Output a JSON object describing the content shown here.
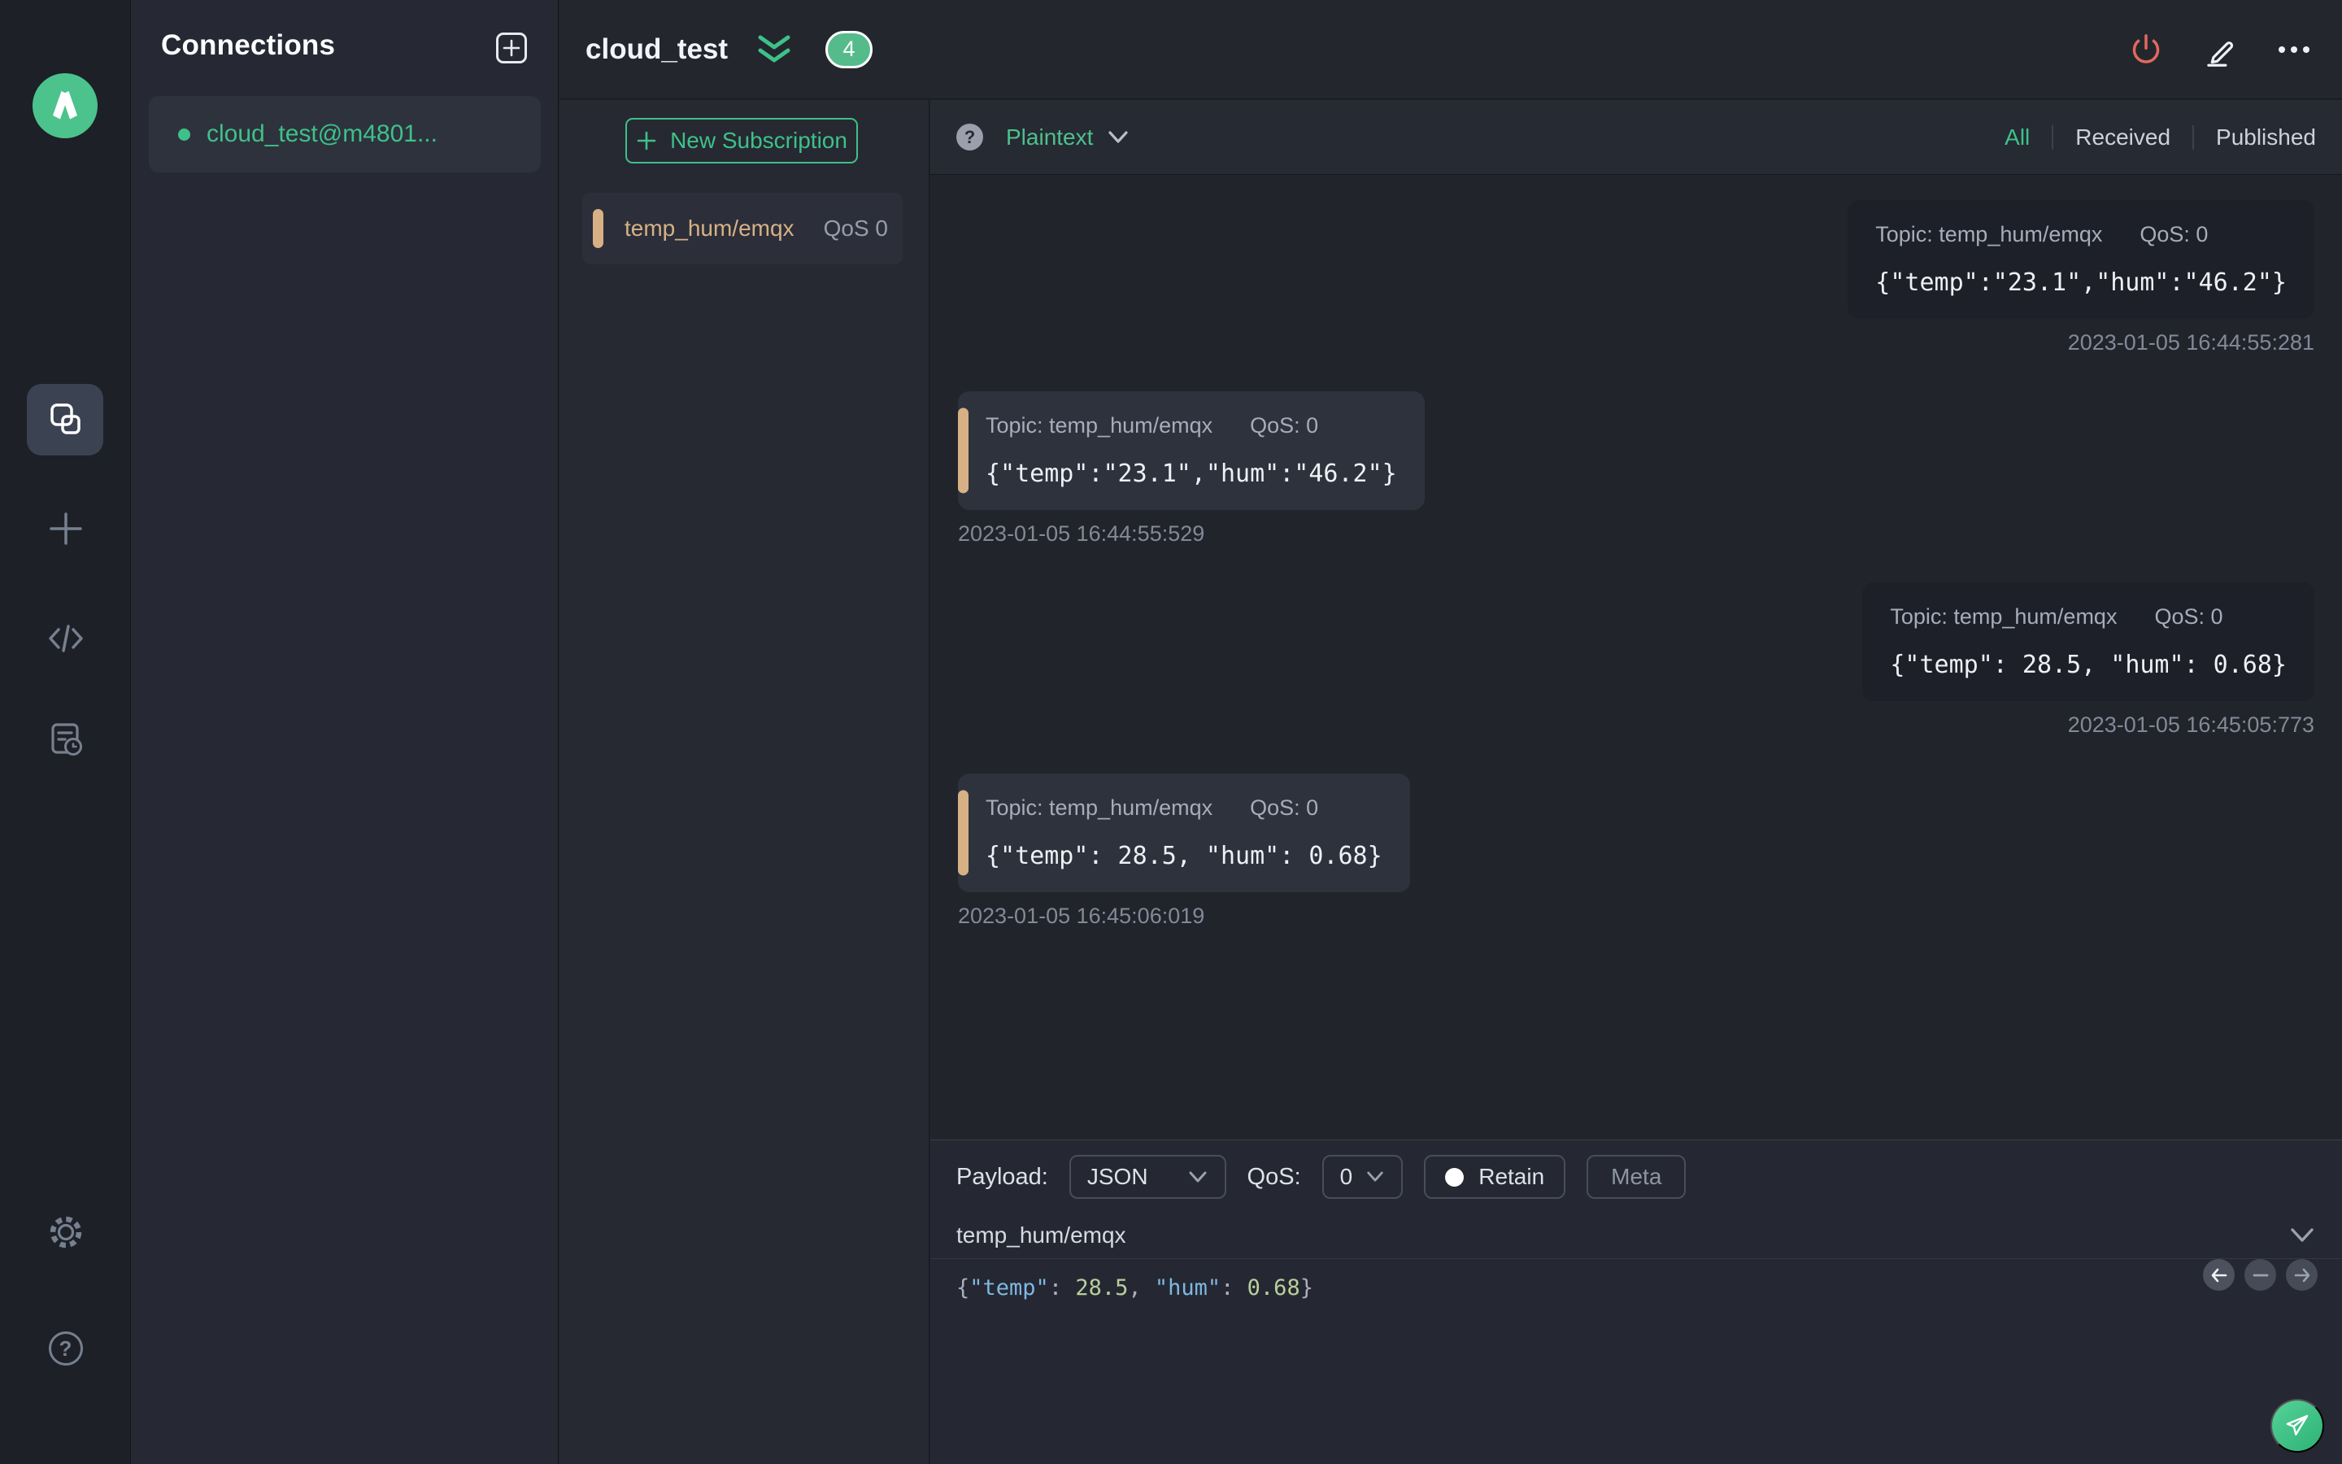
{
  "app": {
    "accent_green": "#3ec189",
    "topic_tan": "#d7b185",
    "danger_red": "#e0695e",
    "syntax": {
      "key": "#7fb8e3",
      "number": "#b8cf9c",
      "punctuation": "#a9b1bd"
    }
  },
  "rail": {
    "help_glyph": "?"
  },
  "connections": {
    "title": "Connections",
    "items": [
      {
        "label": "cloud_test@m4801...",
        "status": "connected"
      }
    ]
  },
  "header": {
    "title": "cloud_test",
    "subscription_count": "4"
  },
  "subscriptions": {
    "new_button_label": "New Subscription",
    "items": [
      {
        "topic": "temp_hum/emqx",
        "qos": "QoS 0"
      }
    ]
  },
  "message_toolbar": {
    "help_glyph": "?",
    "format": "Plaintext",
    "tabs": [
      {
        "label": "All",
        "active": true
      },
      {
        "label": "Received",
        "active": false
      },
      {
        "label": "Published",
        "active": false
      }
    ]
  },
  "messages": [
    {
      "direction": "published",
      "topic": "Topic: temp_hum/emqx",
      "qos": "QoS: 0",
      "payload": "{\"temp\":\"23.1\",\"hum\":\"46.2\"}",
      "timestamp": "2023-01-05 16:44:55:281"
    },
    {
      "direction": "received",
      "topic": "Topic: temp_hum/emqx",
      "qos": "QoS: 0",
      "payload": "{\"temp\":\"23.1\",\"hum\":\"46.2\"}",
      "timestamp": "2023-01-05 16:44:55:529"
    },
    {
      "direction": "published",
      "topic": "Topic: temp_hum/emqx",
      "qos": "QoS: 0",
      "payload": "{\"temp\": 28.5, \"hum\": 0.68}",
      "timestamp": "2023-01-05 16:45:05:773"
    },
    {
      "direction": "received",
      "topic": "Topic: temp_hum/emqx",
      "qos": "QoS: 0",
      "payload": "{\"temp\": 28.5, \"hum\": 0.68}",
      "timestamp": "2023-01-05 16:45:06:019"
    }
  ],
  "publish": {
    "payload_label": "Payload:",
    "format_value": "JSON",
    "qos_label": "QoS:",
    "qos_value": "0",
    "retain_label": "Retain",
    "retain_on": true,
    "meta_label": "Meta",
    "topic_value": "temp_hum/emqx",
    "payload_parts": {
      "open": "{",
      "key1": "\"temp\"",
      "sep1": ": ",
      "val1": "28.5",
      "comma": ", ",
      "key2": "\"hum\"",
      "sep2": ": ",
      "val2": "0.68",
      "close": "}"
    }
  }
}
